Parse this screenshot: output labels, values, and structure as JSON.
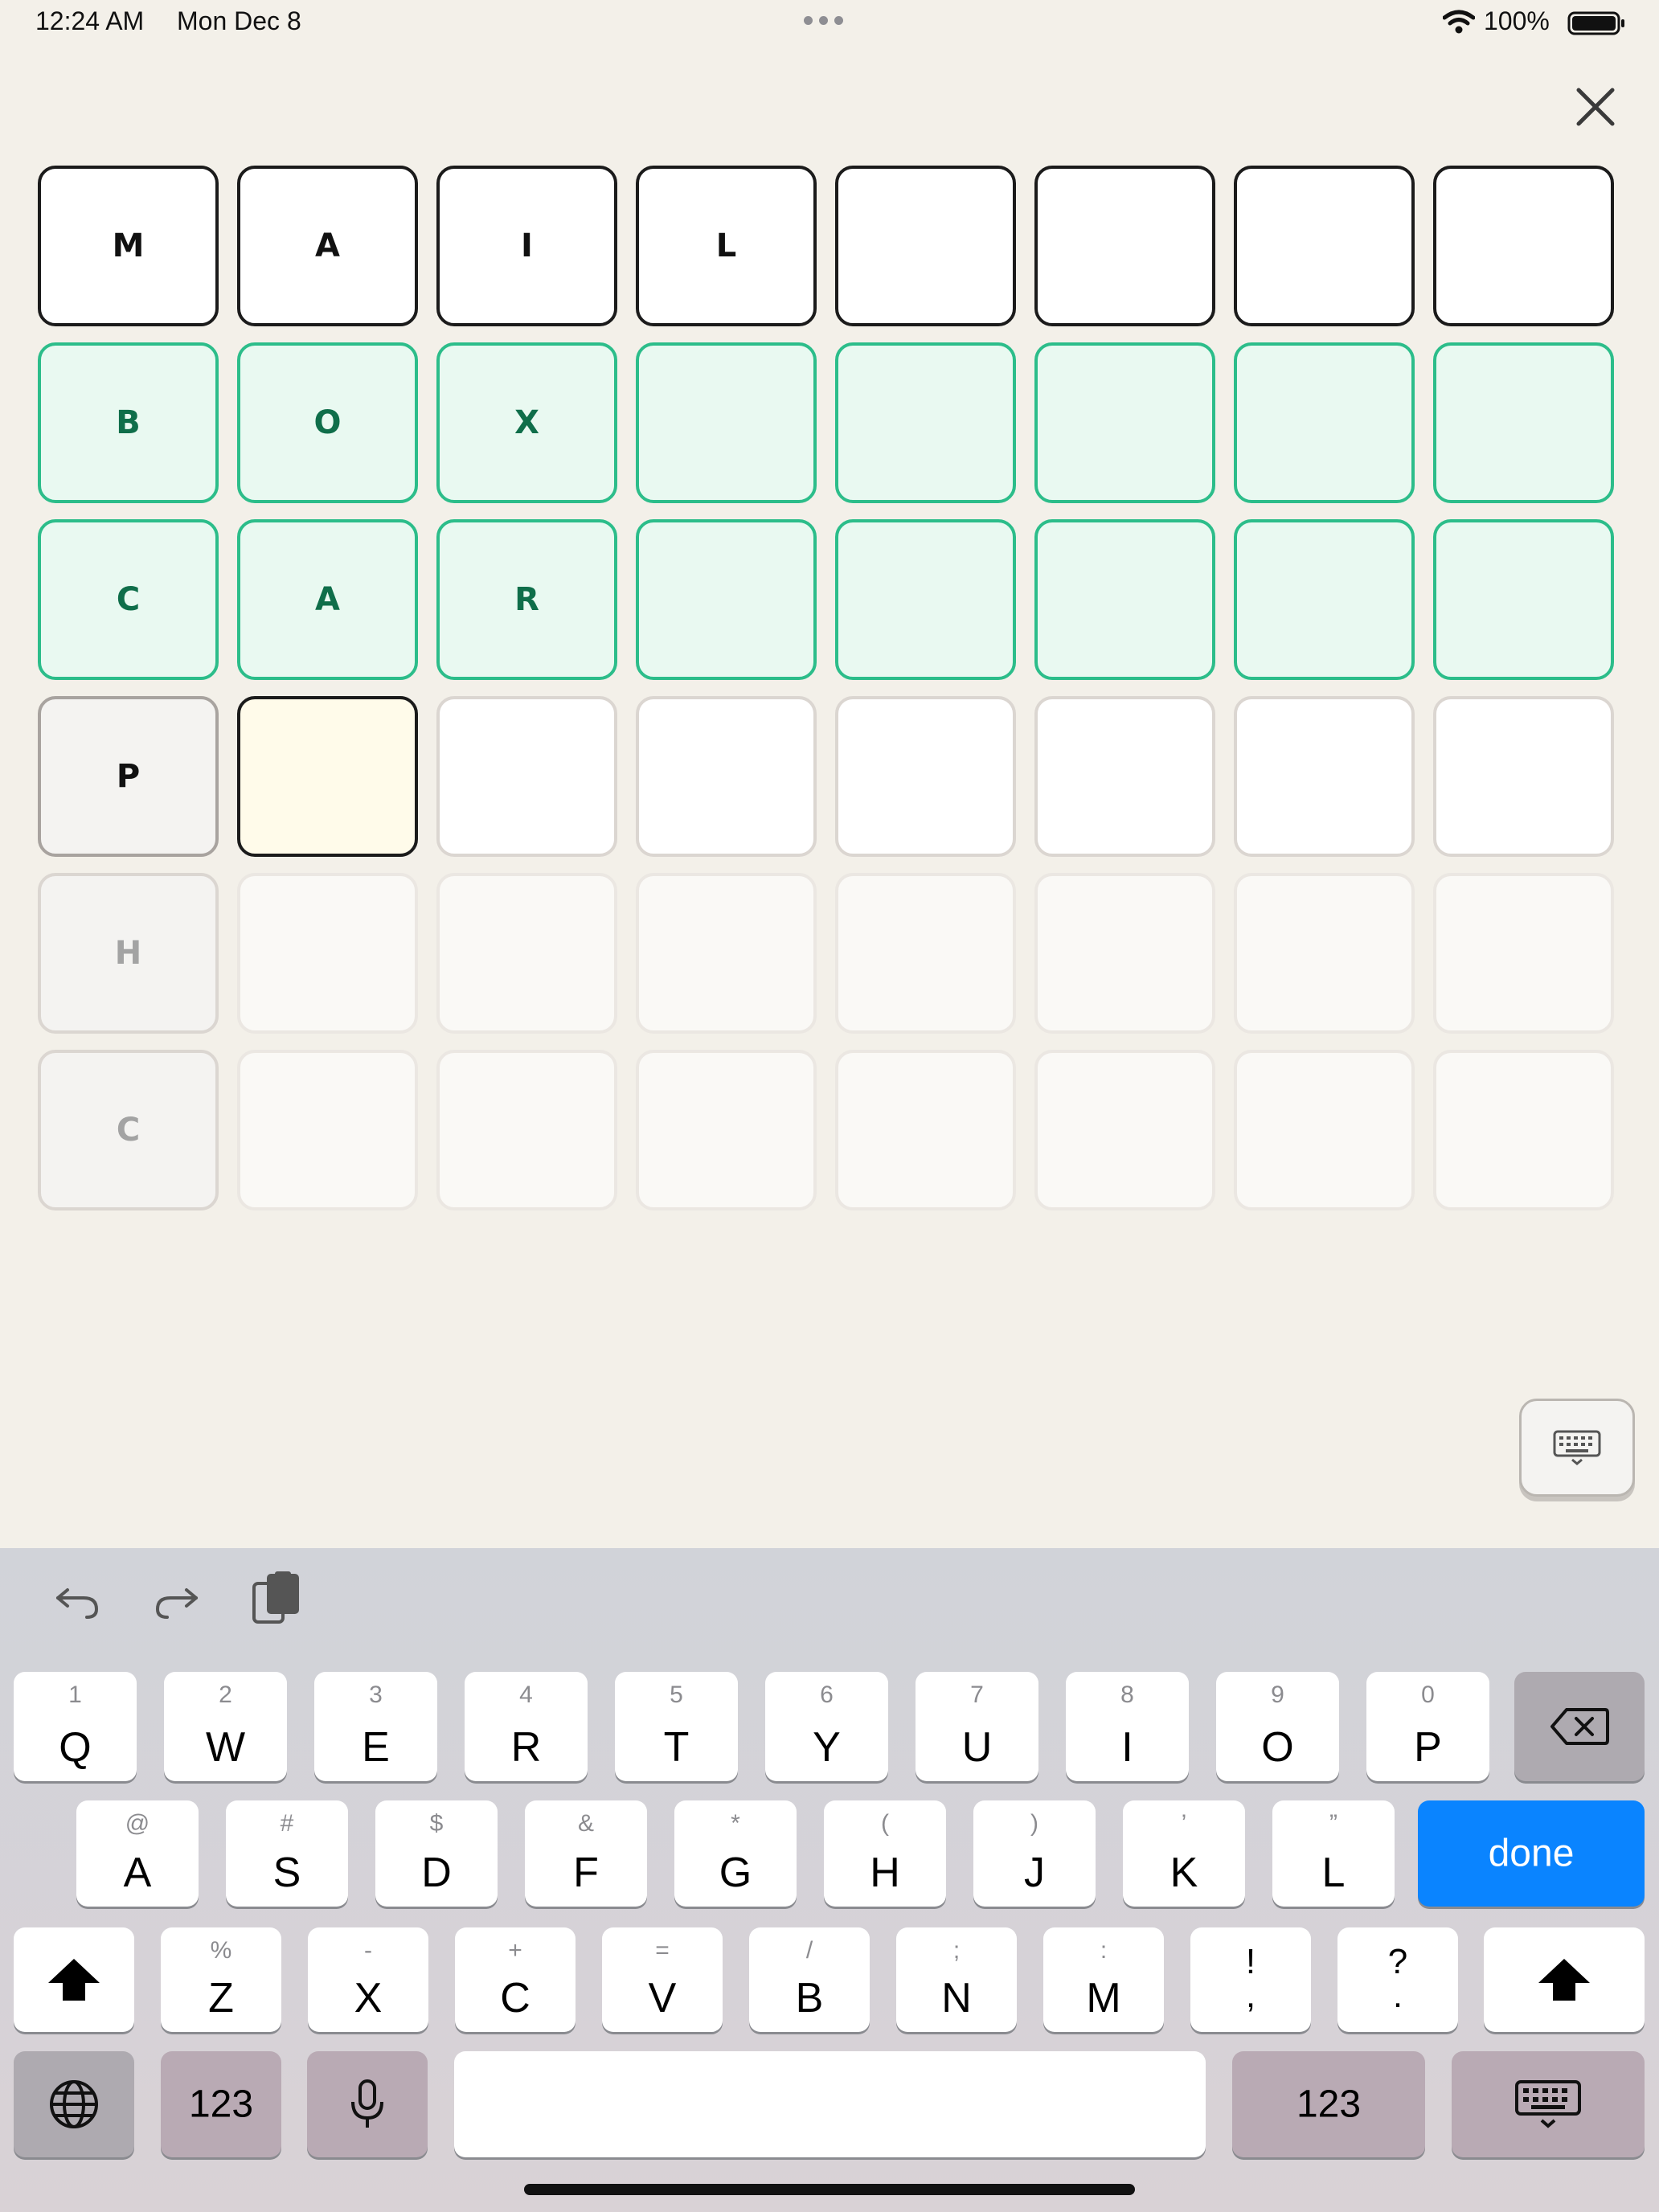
{
  "status_bar": {
    "time": "12:24 AM",
    "date": "Mon Dec 8",
    "battery": "100%"
  },
  "icons": {
    "close": "close-icon",
    "keyboard_dismiss": "keyboard-icon",
    "undo": "undo-icon",
    "redo": "redo-icon",
    "paste": "clipboard-icon",
    "backspace": "backspace-icon",
    "shift": "shift-icon",
    "globe": "globe-icon",
    "mic": "microphone-icon"
  },
  "grid": {
    "rows": [
      {
        "state": "done",
        "letters": [
          "M",
          "A",
          "I",
          "L",
          "",
          "",
          "",
          ""
        ]
      },
      {
        "state": "green",
        "letters": [
          "B",
          "O",
          "X",
          "",
          "",
          "",
          "",
          ""
        ]
      },
      {
        "state": "green",
        "letters": [
          "C",
          "A",
          "R",
          "",
          "",
          "",
          "",
          ""
        ]
      },
      {
        "state": "current",
        "letters": [
          "P",
          "",
          "",
          "",
          "",
          "",
          "",
          ""
        ]
      },
      {
        "state": "future",
        "letters": [
          "H",
          "",
          "",
          "",
          "",
          "",
          "",
          ""
        ]
      },
      {
        "state": "future",
        "letters": [
          "C",
          "",
          "",
          "",
          "",
          "",
          "",
          ""
        ]
      }
    ]
  },
  "keyboard": {
    "row1": [
      {
        "main": "Q",
        "sub": "1"
      },
      {
        "main": "W",
        "sub": "2"
      },
      {
        "main": "E",
        "sub": "3"
      },
      {
        "main": "R",
        "sub": "4"
      },
      {
        "main": "T",
        "sub": "5"
      },
      {
        "main": "Y",
        "sub": "6"
      },
      {
        "main": "U",
        "sub": "7"
      },
      {
        "main": "I",
        "sub": "8"
      },
      {
        "main": "O",
        "sub": "9"
      },
      {
        "main": "P",
        "sub": "0"
      }
    ],
    "row2": [
      {
        "main": "A",
        "sub": "@"
      },
      {
        "main": "S",
        "sub": "#"
      },
      {
        "main": "D",
        "sub": "$"
      },
      {
        "main": "F",
        "sub": "&"
      },
      {
        "main": "G",
        "sub": "*"
      },
      {
        "main": "H",
        "sub": "("
      },
      {
        "main": "J",
        "sub": ")"
      },
      {
        "main": "K",
        "sub": "’"
      },
      {
        "main": "L",
        "sub": "”"
      }
    ],
    "row3": [
      {
        "main": "Z",
        "sub": "%"
      },
      {
        "main": "X",
        "sub": "-"
      },
      {
        "main": "C",
        "sub": "+"
      },
      {
        "main": "V",
        "sub": "="
      },
      {
        "main": "B",
        "sub": "/"
      },
      {
        "main": "N",
        "sub": ";"
      },
      {
        "main": "M",
        "sub": ":"
      }
    ],
    "punct1": {
      "top": "!",
      "bottom": ","
    },
    "punct2": {
      "top": "?",
      "bottom": "."
    },
    "done_label": "done",
    "numbers_label": "123",
    "accent_color": "#0a84ff"
  }
}
